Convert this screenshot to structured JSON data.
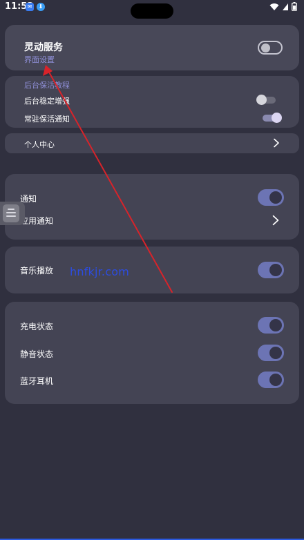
{
  "status_bar": {
    "time": "11:52"
  },
  "service_card": {
    "title": "灵动服务",
    "link": "界面设置",
    "enabled": false
  },
  "keep_alive_card": {
    "header": "后台保活教程",
    "items": [
      {
        "label": "后台稳定增强",
        "enabled": false
      },
      {
        "label": "常驻保活通知",
        "enabled": true
      }
    ]
  },
  "profile_row": {
    "label": "个人中心"
  },
  "notify_card": {
    "items": [
      {
        "label": "通知",
        "enabled": true
      },
      {
        "label": "应用通知"
      }
    ]
  },
  "music_card": {
    "label": "音乐播放",
    "enabled": true
  },
  "watermark": {
    "text": "hnfkjr.com"
  },
  "status_card": {
    "items": [
      {
        "label": "充电状态",
        "enabled": true
      },
      {
        "label": "静音状态",
        "enabled": true
      },
      {
        "label": "蓝牙耳机",
        "enabled": true
      }
    ]
  },
  "colors": {
    "background": "#30303f",
    "card": "#444454",
    "accent": "#6c74b4",
    "link": "#8f8fd8",
    "arrow": "#d8232a",
    "watermark": "#2c4ce0"
  }
}
